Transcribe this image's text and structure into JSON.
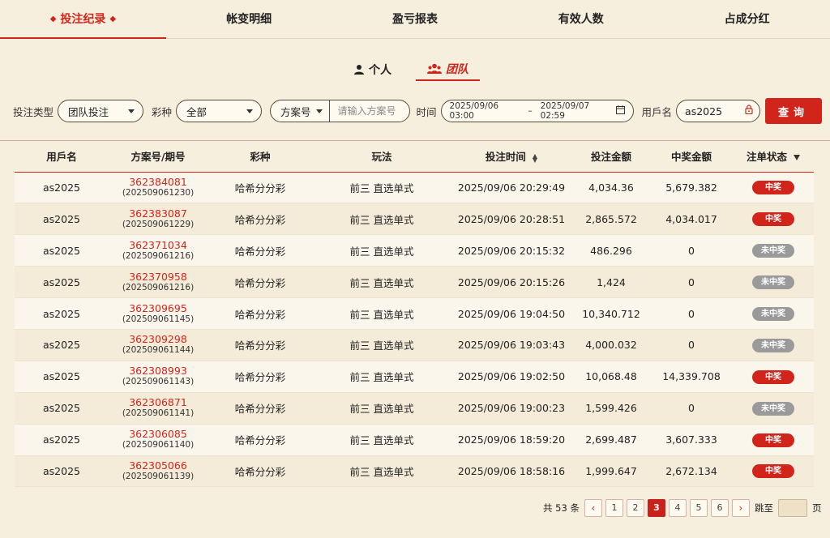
{
  "tabs": [
    {
      "label": "投注纪录",
      "active": true
    },
    {
      "label": "帐变明细",
      "active": false
    },
    {
      "label": "盈亏报表",
      "active": false
    },
    {
      "label": "有效人数",
      "active": false
    },
    {
      "label": "占成分红",
      "active": false
    }
  ],
  "mode": {
    "personal": "个人",
    "team": "团队",
    "active": "team"
  },
  "filters": {
    "bet_type_label": "投注类型",
    "bet_type_value": "团队投注",
    "lottery_label": "彩种",
    "lottery_value": "全部",
    "scheme_select": "方案号",
    "scheme_placeholder": "请输入方案号",
    "time_label": "时间",
    "time_start": "2025/09/06 03:00",
    "time_sep": "–",
    "time_end": "2025/09/07 02:59",
    "user_label": "用戶名",
    "user_value": "as2025",
    "query_button": "查询"
  },
  "table": {
    "headers": [
      "用戶名",
      "方案号/期号",
      "彩种",
      "玩法",
      "投注时间",
      "投注金额",
      "中奖金额",
      "注单状态"
    ],
    "rows": [
      {
        "user": "as2025",
        "scheme": "362384081",
        "issue": "(202509061230)",
        "lottery": "哈希分分彩",
        "play": "前三 直选单式",
        "time": "2025/09/06 20:29:49",
        "bet": "4,034.36",
        "win": "5,679.382",
        "status": "中奖",
        "won": true
      },
      {
        "user": "as2025",
        "scheme": "362383087",
        "issue": "(202509061229)",
        "lottery": "哈希分分彩",
        "play": "前三 直选单式",
        "time": "2025/09/06 20:28:51",
        "bet": "2,865.572",
        "win": "4,034.017",
        "status": "中奖",
        "won": true
      },
      {
        "user": "as2025",
        "scheme": "362371034",
        "issue": "(202509061216)",
        "lottery": "哈希分分彩",
        "play": "前三 直选单式",
        "time": "2025/09/06 20:15:32",
        "bet": "486.296",
        "win": "0",
        "status": "未中奖",
        "won": false
      },
      {
        "user": "as2025",
        "scheme": "362370958",
        "issue": "(202509061216)",
        "lottery": "哈希分分彩",
        "play": "前三 直选单式",
        "time": "2025/09/06 20:15:26",
        "bet": "1,424",
        "win": "0",
        "status": "未中奖",
        "won": false
      },
      {
        "user": "as2025",
        "scheme": "362309695",
        "issue": "(202509061145)",
        "lottery": "哈希分分彩",
        "play": "前三 直选单式",
        "time": "2025/09/06 19:04:50",
        "bet": "10,340.712",
        "win": "0",
        "status": "未中奖",
        "won": false
      },
      {
        "user": "as2025",
        "scheme": "362309298",
        "issue": "(202509061144)",
        "lottery": "哈希分分彩",
        "play": "前三 直选单式",
        "time": "2025/09/06 19:03:43",
        "bet": "4,000.032",
        "win": "0",
        "status": "未中奖",
        "won": false
      },
      {
        "user": "as2025",
        "scheme": "362308993",
        "issue": "(202509061143)",
        "lottery": "哈希分分彩",
        "play": "前三 直选单式",
        "time": "2025/09/06 19:02:50",
        "bet": "10,068.48",
        "win": "14,339.708",
        "status": "中奖",
        "won": true
      },
      {
        "user": "as2025",
        "scheme": "362306871",
        "issue": "(202509061141)",
        "lottery": "哈希分分彩",
        "play": "前三 直选单式",
        "time": "2025/09/06 19:00:23",
        "bet": "1,599.426",
        "win": "0",
        "status": "未中奖",
        "won": false
      },
      {
        "user": "as2025",
        "scheme": "362306085",
        "issue": "(202509061140)",
        "lottery": "哈希分分彩",
        "play": "前三 直选单式",
        "time": "2025/09/06 18:59:20",
        "bet": "2,699.487",
        "win": "3,607.333",
        "status": "中奖",
        "won": true
      },
      {
        "user": "as2025",
        "scheme": "362305066",
        "issue": "(202509061139)",
        "lottery": "哈希分分彩",
        "play": "前三 直选单式",
        "time": "2025/09/06 18:58:16",
        "bet": "1,999.647",
        "win": "2,672.134",
        "status": "中奖",
        "won": true
      }
    ]
  },
  "pagination": {
    "total_text": "共 53 条",
    "pages": [
      "1",
      "2",
      "3",
      "4",
      "5",
      "6"
    ],
    "current": "3",
    "jump_label": "跳至",
    "page_suffix": "页"
  },
  "colors": {
    "accent": "#d1251c",
    "win_badge": "#d1251c",
    "lose_badge": "#9a9a9a",
    "background": "#f7efdd"
  }
}
